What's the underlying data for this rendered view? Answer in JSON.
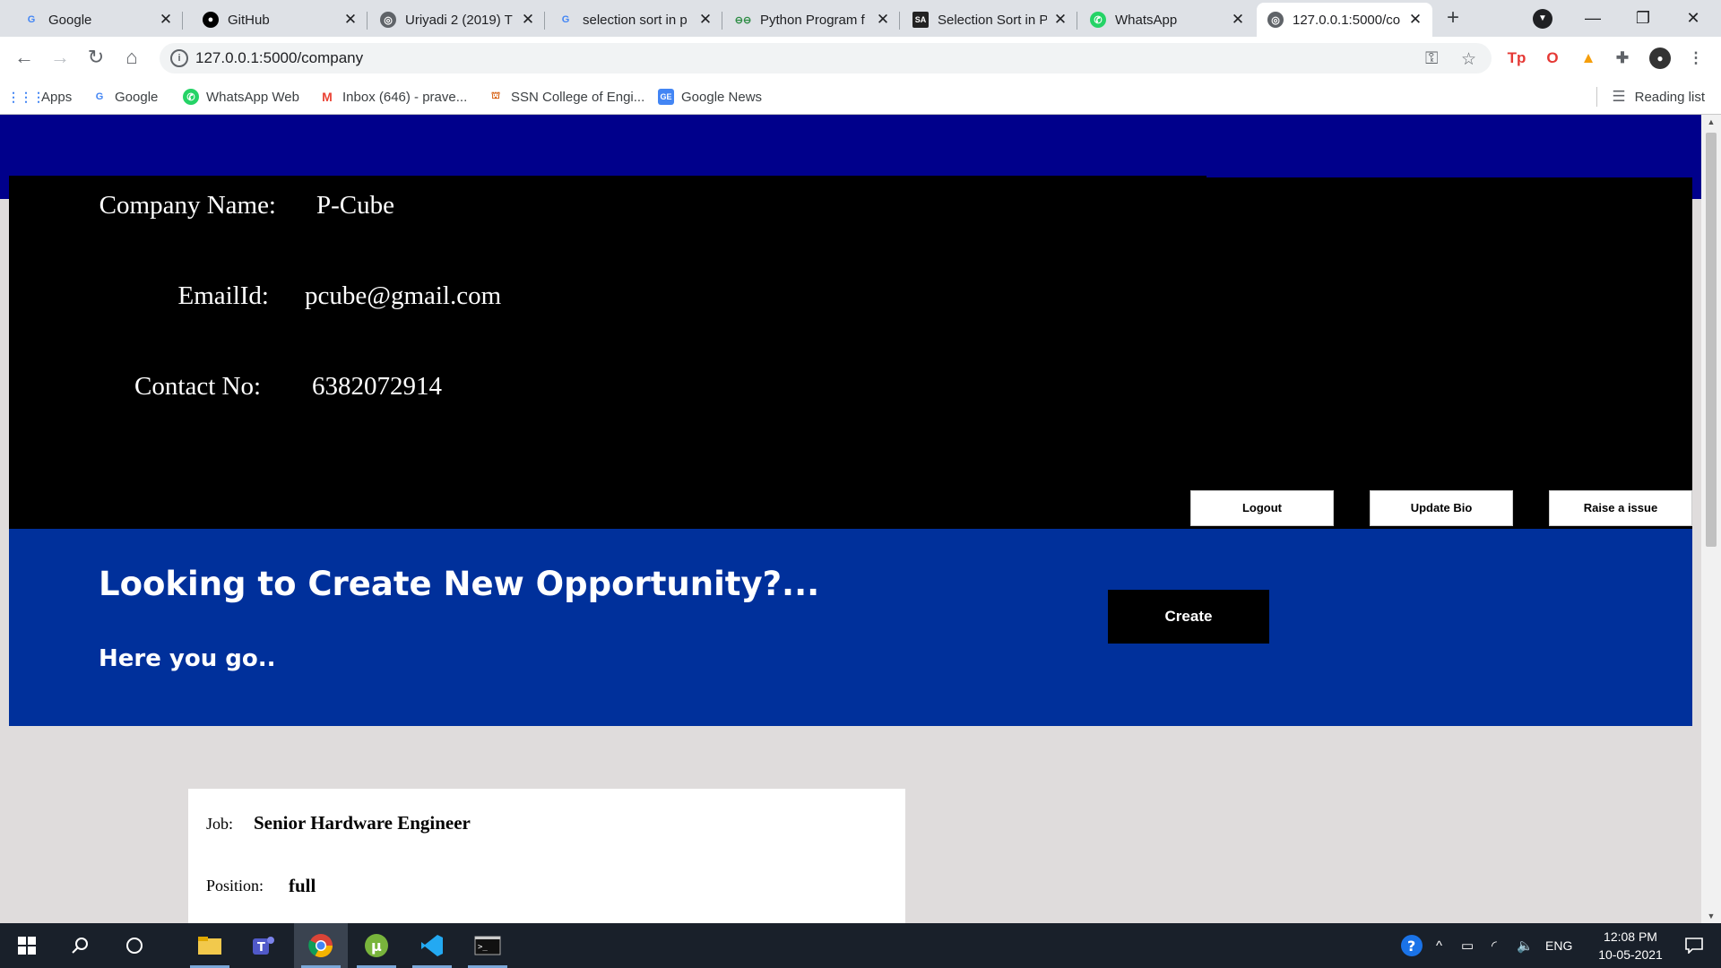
{
  "browser": {
    "tabs": [
      {
        "title": "Google",
        "icon": "google-icon",
        "active": false
      },
      {
        "title": "GitHub",
        "icon": "github-icon",
        "active": false
      },
      {
        "title": "Uriyadi 2 (2019) T",
        "icon": "globe-icon",
        "active": false
      },
      {
        "title": "selection sort in p",
        "icon": "google-icon",
        "active": false
      },
      {
        "title": "Python Program f",
        "icon": "geeksforgeeks-icon",
        "active": false
      },
      {
        "title": "Selection Sort in P",
        "icon": "stackabuse-icon",
        "active": false
      },
      {
        "title": "WhatsApp",
        "icon": "whatsapp-icon",
        "active": false
      },
      {
        "title": "127.0.0.1:5000/co",
        "icon": "globe-icon",
        "active": true
      }
    ],
    "url": "127.0.0.1:5000/company",
    "bookmarks": [
      {
        "label": "Apps",
        "icon": "apps-grid-icon"
      },
      {
        "label": "Google",
        "icon": "google-icon"
      },
      {
        "label": "WhatsApp Web",
        "icon": "whatsapp-icon"
      },
      {
        "label": "Inbox (646) - prave...",
        "icon": "gmail-icon"
      },
      {
        "label": "SSN College of Engi...",
        "icon": "college-icon"
      },
      {
        "label": "Google News",
        "icon": "google-news-icon"
      }
    ],
    "reading_list": "Reading list"
  },
  "page": {
    "profile": {
      "company_label": "Company Name:",
      "company_value": "P-Cube",
      "email_label": "EmailId:",
      "email_value": "pcube@gmail.com",
      "contact_label": "Contact No:",
      "contact_value": "6382072914",
      "buttons": {
        "logout": "Logout",
        "update_bio": "Update Bio",
        "raise_issue": "Raise a issue"
      }
    },
    "opportunity": {
      "title": "Looking to Create New Opportunity?...",
      "subtitle": "Here you go..",
      "create_label": "Create"
    },
    "job": {
      "job_label": "Job:",
      "job_value": "Senior Hardware Engineer",
      "position_label": "Position:",
      "position_value": "full"
    }
  },
  "taskbar": {
    "language": "ENG",
    "time": "12:08 PM",
    "date": "10-05-2021"
  },
  "colors": {
    "top_band": "#00008b",
    "profile_bg": "#000000",
    "opportunity_bg": "#00309b",
    "page_bg": "#dfdcdc"
  }
}
